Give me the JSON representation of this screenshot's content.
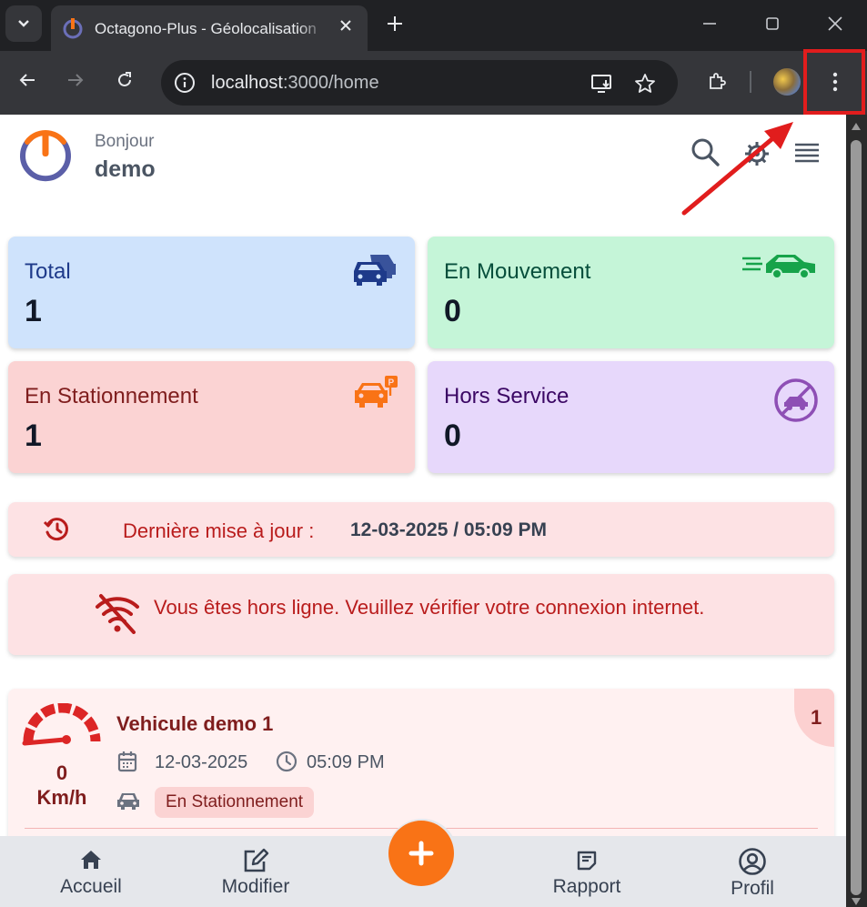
{
  "browser": {
    "tab_title": "Octagono-Plus - Géolocalisation",
    "url_host": "localhost",
    "url_rest": ":3000/home"
  },
  "header": {
    "greeting": "Bonjour",
    "username": "demo"
  },
  "stats": [
    {
      "label": "Total",
      "value": "1",
      "icon": "cars-icon",
      "color": "#1e3a8a",
      "bg": "#cfe3fc"
    },
    {
      "label": "En Mouvement",
      "value": "0",
      "icon": "moving-car-icon",
      "color": "#064e3b",
      "bg": "#c5f5d8"
    },
    {
      "label": "En Stationnement",
      "value": "1",
      "icon": "parked-car-icon",
      "color": "#7f1d1d",
      "bg": "#fbd3d3"
    },
    {
      "label": "Hors Service",
      "value": "0",
      "icon": "no-car-icon",
      "color": "#3b0764",
      "bg": "#e7d8fb"
    }
  ],
  "last_update": {
    "label": "Dernière mise à jour :",
    "value": "12-03-2025 / 05:09 PM"
  },
  "offline": {
    "message": "Vous êtes hors ligne. Veuillez vérifier votre connexion internet."
  },
  "vehicle": {
    "name": "Vehicule demo 1",
    "date": "12-03-2025",
    "time": "05:09 PM",
    "speed": "0",
    "speed_unit": "Km/h",
    "status": "En Stationnement",
    "index": "1"
  },
  "nav": {
    "accueil": "Accueil",
    "modifier": "Modifier",
    "add": "+",
    "rapport": "Rapport",
    "profil": "Profil"
  },
  "colors": {
    "accent": "#f97316",
    "logo_blue": "#5b5fa8",
    "annotation_red": "#e11d1d"
  }
}
